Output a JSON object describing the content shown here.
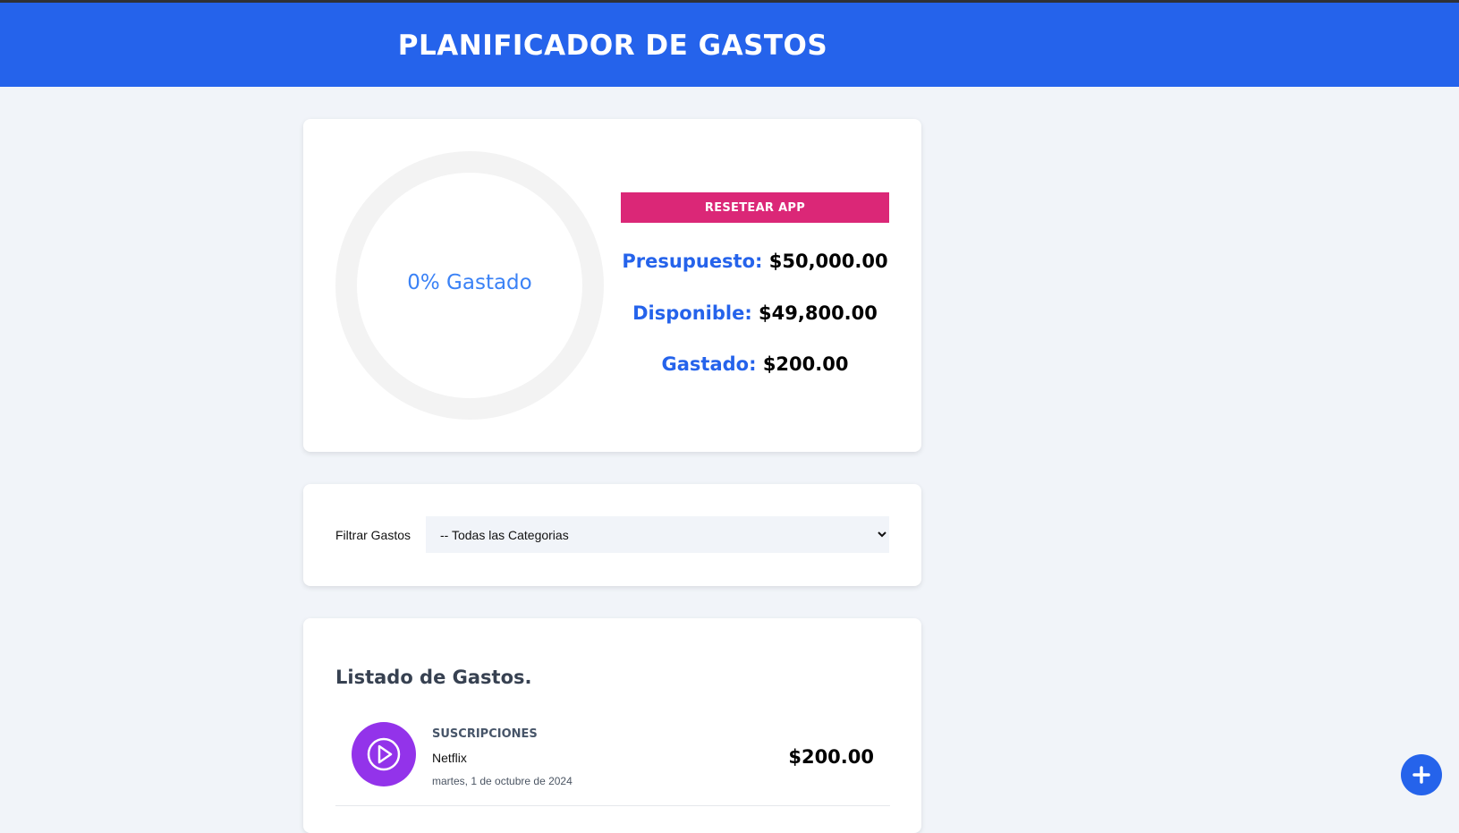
{
  "header": {
    "title": "PLANIFICADOR DE GASTOS"
  },
  "budget": {
    "progress_text": "0% Gastado",
    "progress_fraction": 0,
    "reset_label": "RESETEAR APP",
    "presupuesto_label": "Presupuesto:",
    "presupuesto_value": "$50,000.00",
    "disponible_label": "Disponible:",
    "disponible_value": "$49,800.00",
    "gastado_label": "Gastado:",
    "gastado_value": "$200.00"
  },
  "filter": {
    "label": "Filtrar Gastos",
    "selected": "-- Todas las Categorias"
  },
  "list": {
    "title": "Listado de Gastos.",
    "items": [
      {
        "category": "SUSCRIPCIONES",
        "name": "Netflix",
        "date": "martes, 1 de octubre de 2024",
        "amount": "$200.00",
        "icon": "play-icon"
      }
    ]
  },
  "colors": {
    "primary": "#2563eb",
    "reset": "#db2777",
    "subscriptions": "#9333ea"
  }
}
